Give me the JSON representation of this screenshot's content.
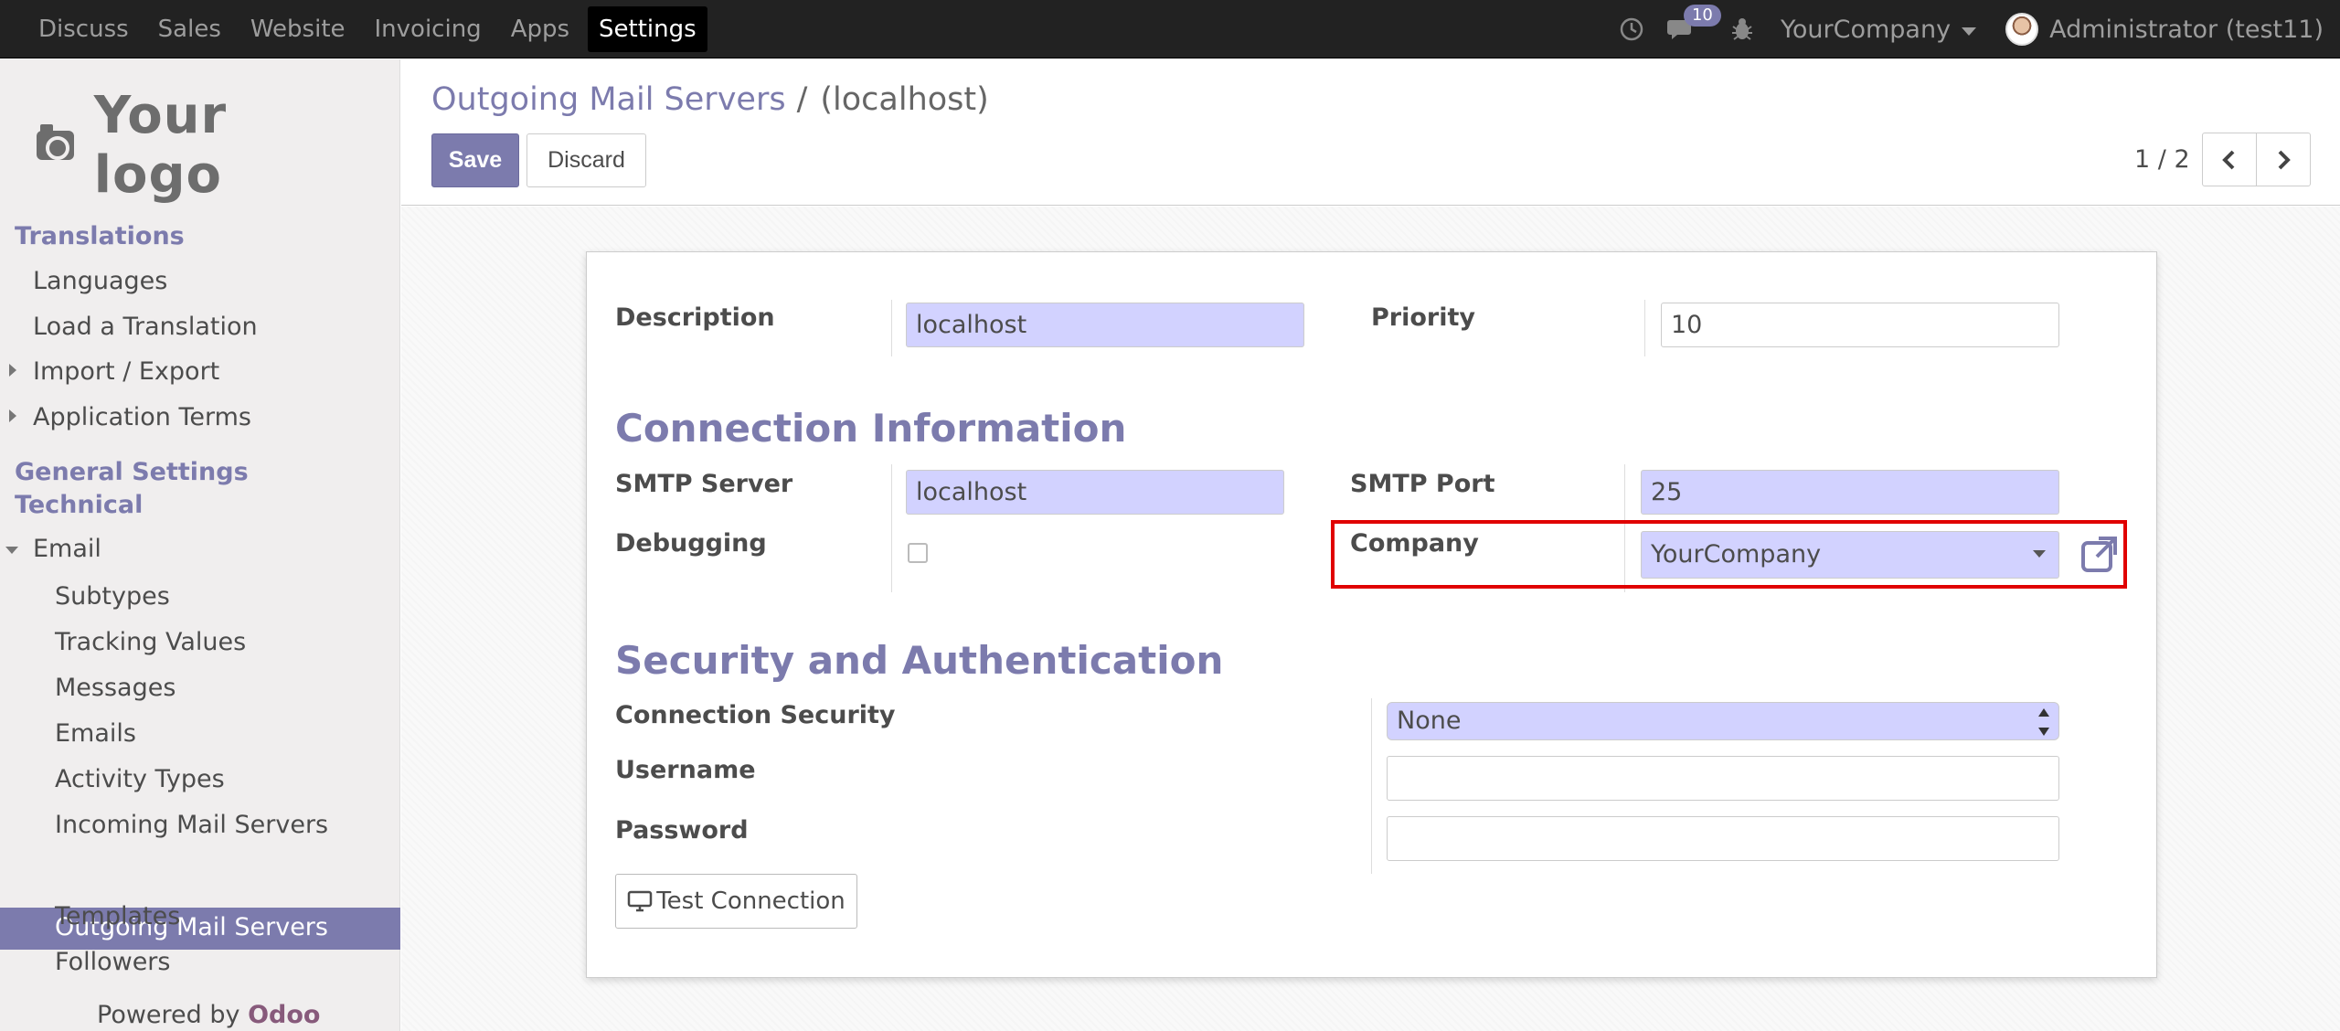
{
  "navbar": {
    "menu": [
      "Discuss",
      "Sales",
      "Website",
      "Invoicing",
      "Apps",
      "Settings"
    ],
    "active": "Settings",
    "messages_badge": "10",
    "company": "YourCompany",
    "user": "Administrator (test11)"
  },
  "sidebar": {
    "logo_text": "Your logo",
    "translations_heading": "Translations",
    "languages": "Languages",
    "load_translation": "Load a Translation",
    "import_export": "Import / Export",
    "application_terms": "Application Terms",
    "general_settings": "General Settings",
    "technical": "Technical",
    "email": "Email",
    "email_items": [
      "Subtypes",
      "Tracking Values",
      "Messages",
      "Emails",
      "Activity Types",
      "Incoming Mail Servers",
      "Outgoing Mail Servers",
      "Templates",
      "Followers"
    ],
    "active_item": "Outgoing Mail Servers",
    "powered_by": "Powered by",
    "powered_brand": "Odoo"
  },
  "control_panel": {
    "breadcrumb_parent": "Outgoing Mail Servers",
    "breadcrumb_sep": "/",
    "breadcrumb_current": "(localhost)",
    "save_label": "Save",
    "discard_label": "Discard",
    "pager": "1 / 2"
  },
  "form": {
    "description_label": "Description",
    "description_value": "localhost",
    "priority_label": "Priority",
    "priority_value": "10",
    "connection_heading": "Connection Information",
    "smtp_server_label": "SMTP Server",
    "smtp_server_value": "localhost",
    "smtp_port_label": "SMTP Port",
    "smtp_port_value": "25",
    "debugging_label": "Debugging",
    "company_label": "Company",
    "company_value": "YourCompany",
    "security_heading": "Security and Authentication",
    "connection_security_label": "Connection Security",
    "connection_security_value": "None",
    "username_label": "Username",
    "password_label": "Password",
    "test_connection_label": "Test Connection"
  },
  "colors": {
    "brand": "#7c7bad",
    "required_field": "#d2d2ff",
    "highlight": "#e00000"
  }
}
